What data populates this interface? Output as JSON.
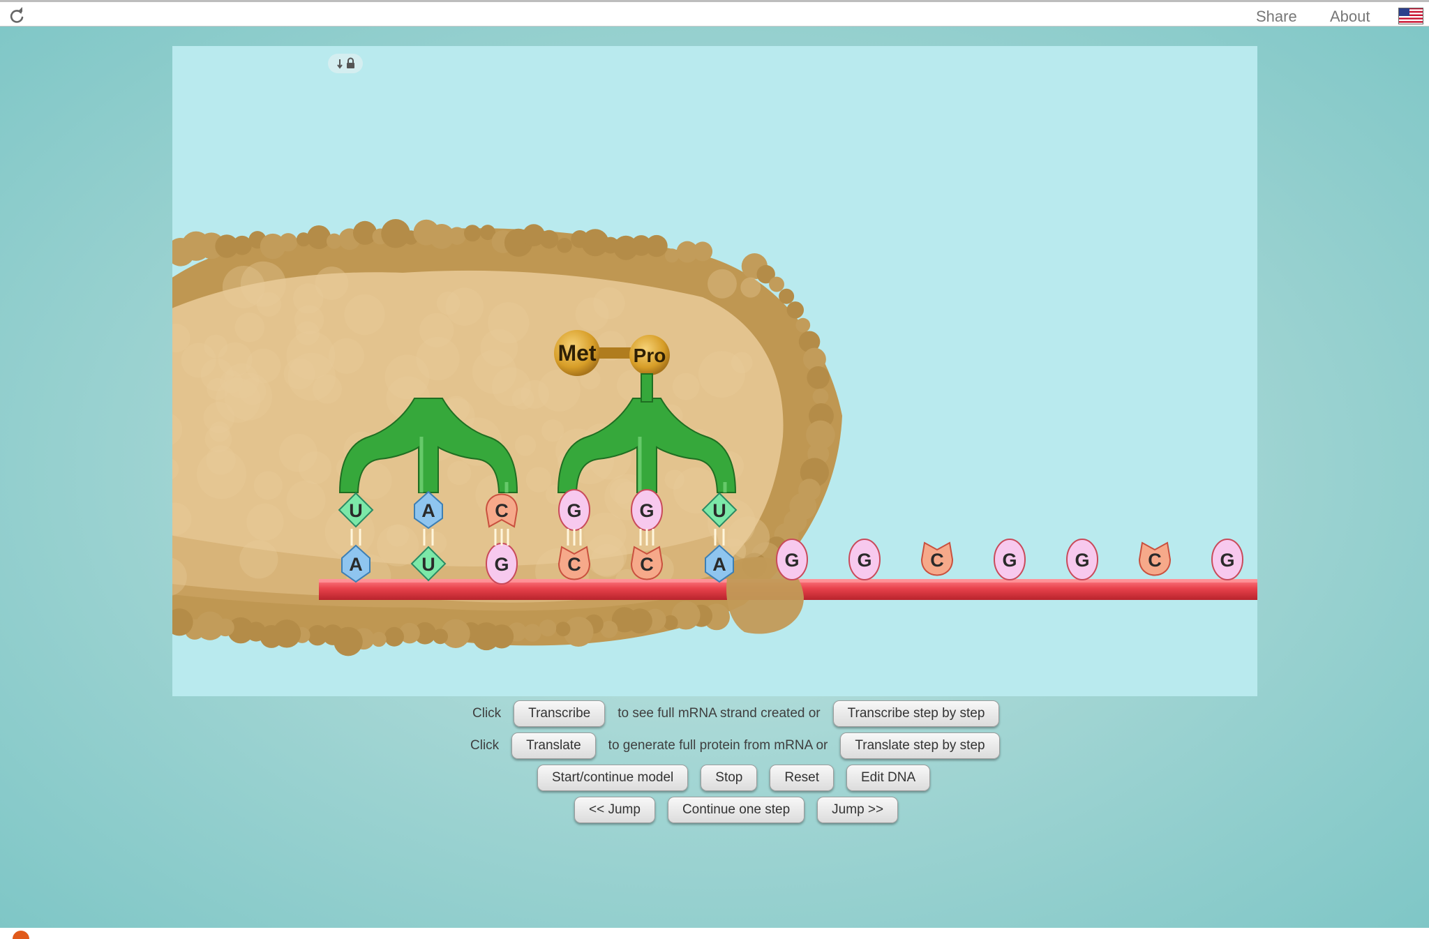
{
  "header": {
    "share_label": "Share",
    "about_label": "About"
  },
  "model": {
    "amino_acids": [
      "Met",
      "Pro"
    ],
    "trna_anticodons": [
      [
        "U",
        "A",
        "C"
      ],
      [
        "G",
        "G",
        "U"
      ]
    ],
    "mrna_in_ribosome": [
      "A",
      "U",
      "G",
      "C",
      "C",
      "A"
    ],
    "mrna_outside": [
      "G",
      "G",
      "C",
      "G",
      "G",
      "C",
      "G"
    ],
    "colors": {
      "A": "#8fc5ef",
      "U": "#7ce8a8",
      "G": "#f7c9ee",
      "C": "#f6a98a",
      "trna": "#36a83b",
      "mrna_strand": "#e8424c",
      "ribosome": "#e3c38e",
      "amino_acid": "#d79e28"
    }
  },
  "controls": {
    "row1": {
      "prefix": "Click",
      "button1": "Transcribe",
      "middle": "to see full mRNA strand created or",
      "button2": "Transcribe step by step"
    },
    "row2": {
      "prefix": "Click",
      "button1": "Translate",
      "middle": "to generate full protein from mRNA or",
      "button2": "Translate step by step"
    },
    "row3": {
      "start": "Start/continue model",
      "stop": "Stop",
      "reset": "Reset",
      "edit": "Edit DNA"
    },
    "row4": {
      "jump_back": "<< Jump",
      "continue": "Continue one step",
      "jump_forward": "Jump >>"
    }
  }
}
